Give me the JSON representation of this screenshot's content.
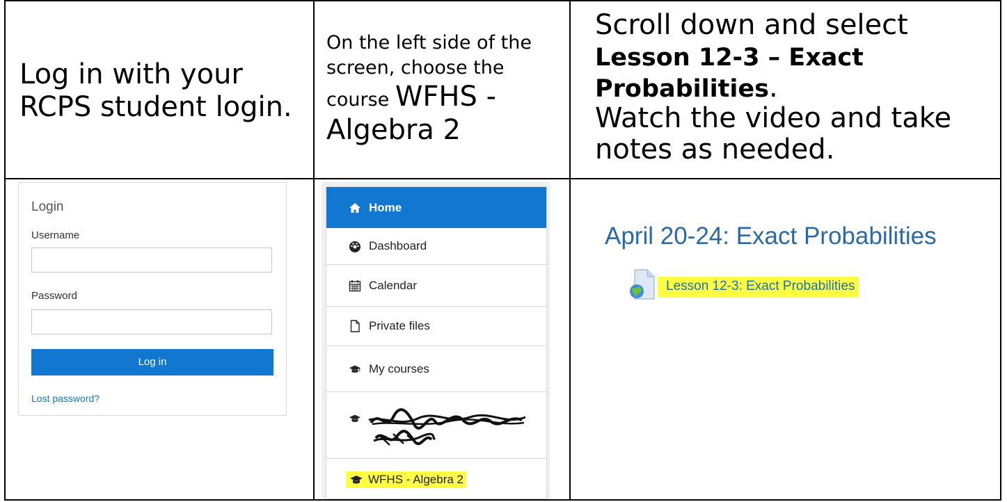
{
  "instructions": {
    "step1": "Log in with your RCPS student login.",
    "step2_prefix": "On the left side of the screen, choose the course",
    "step2_course": "WFHS - Algebra 2",
    "step3_intro": "Scroll down and select",
    "step3_lesson": "Lesson 12-3 – Exact Probabilities",
    "step3_period": ".",
    "step3_outro": "Watch the video and take notes as needed."
  },
  "login": {
    "title": "Login",
    "username_label": "Username",
    "username_value": "",
    "password_label": "Password",
    "password_value": "",
    "button_label": "Log in",
    "lost_password": "Lost password?"
  },
  "nav": {
    "items": [
      {
        "label": "Home",
        "icon": "home-icon"
      },
      {
        "label": "Dashboard",
        "icon": "dashboard-icon"
      },
      {
        "label": "Calendar",
        "icon": "calendar-icon"
      },
      {
        "label": "Private files",
        "icon": "file-icon"
      },
      {
        "label": "My courses",
        "icon": "graduation-cap-icon"
      },
      {
        "label": "",
        "icon": "graduation-cap-icon"
      },
      {
        "label": "WFHS - Algebra 2",
        "icon": "graduation-cap-icon"
      }
    ]
  },
  "course_page": {
    "section_title": "April 20-24: Exact Probabilities",
    "lesson_link": "Lesson 12-3: Exact Probabilities"
  },
  "colors": {
    "accent": "#1177d1",
    "highlight": "#ffff44",
    "section_title": "#2a6aa8"
  }
}
